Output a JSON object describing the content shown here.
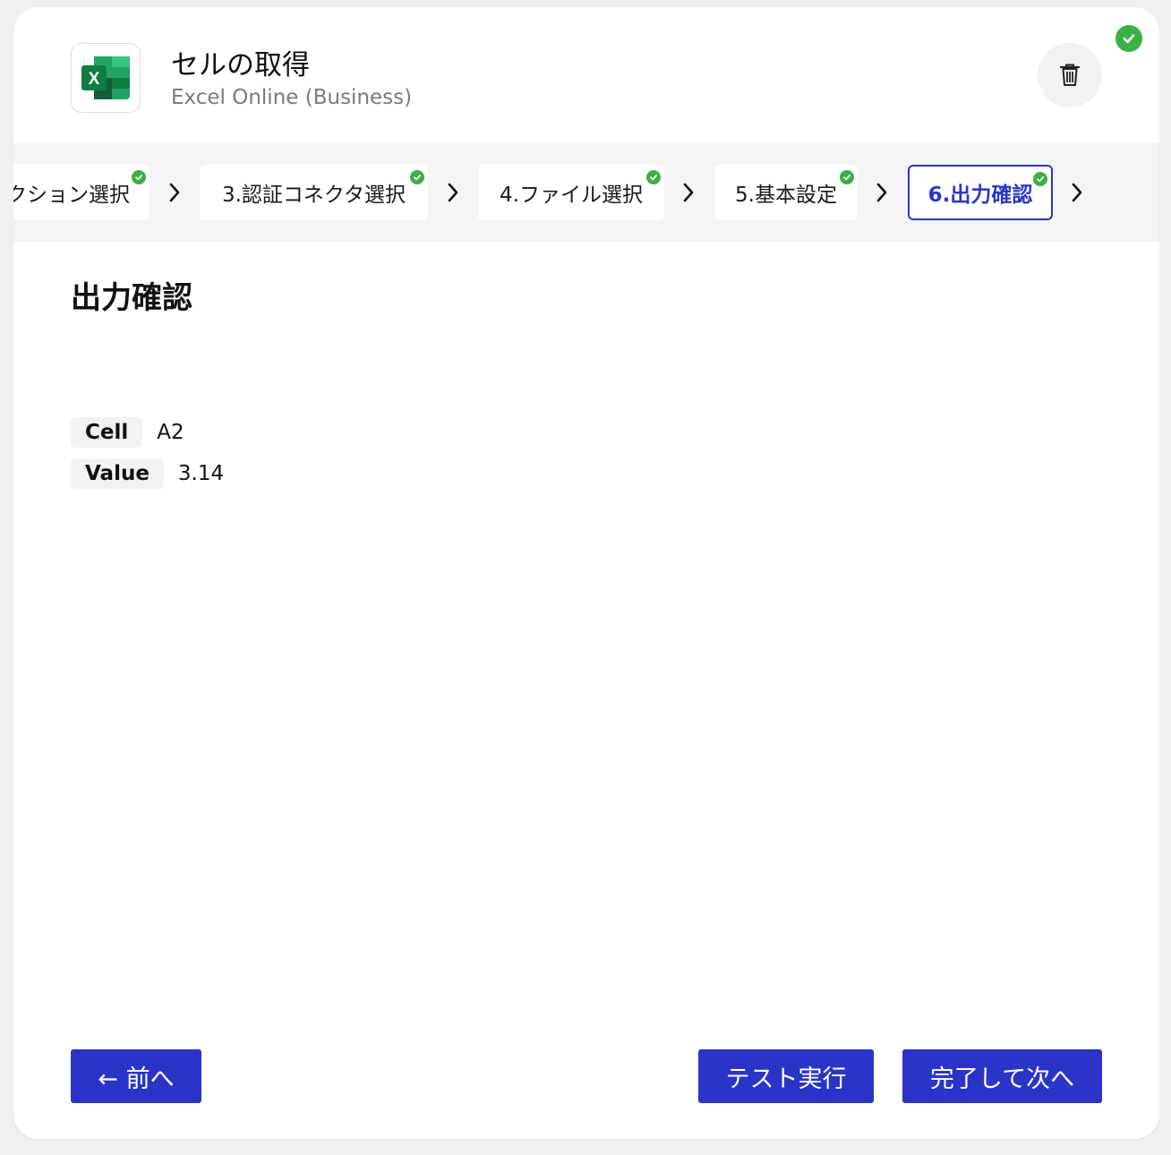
{
  "header": {
    "title": "セルの取得",
    "subtitle": "Excel Online (Business)",
    "logo_letter": "X",
    "logo_icon": "excel-icon",
    "delete_icon": "trash-icon",
    "status_icon": "check-circle-icon"
  },
  "steps": [
    {
      "label": "アクション選択",
      "complete": true,
      "active": false
    },
    {
      "label": "3.認証コネクタ選択",
      "complete": true,
      "active": false
    },
    {
      "label": "4.ファイル選択",
      "complete": true,
      "active": false
    },
    {
      "label": "5.基本設定",
      "complete": true,
      "active": false
    },
    {
      "label": "6.出力確認",
      "complete": true,
      "active": true
    }
  ],
  "main": {
    "section_title": "出力確認",
    "outputs": [
      {
        "key": "Cell",
        "value": "A2"
      },
      {
        "key": "Value",
        "value": "3.14"
      }
    ]
  },
  "footer": {
    "prev_label": "← 前へ",
    "test_label": "テスト実行",
    "next_label": "完了して次へ"
  },
  "colors": {
    "accent": "#2a35c7",
    "success": "#3cb043",
    "excel_dark": "#185c37",
    "excel_mid": "#21a366",
    "excel_light": "#33c481"
  }
}
